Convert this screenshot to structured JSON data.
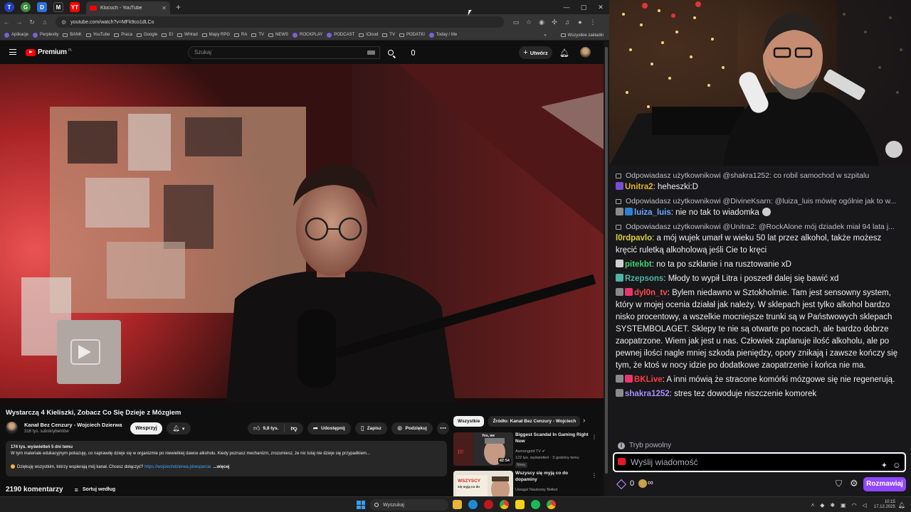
{
  "browser": {
    "tab_title": "Klocuch - YouTube",
    "pinned_tabs": [
      "T",
      "G",
      "D",
      "M",
      "YT"
    ],
    "url": "youtube.com/watch?v=MFk9co1dLCo",
    "bookmarks": [
      "Aplikacje",
      "Perplexity",
      "BANK",
      "YouTube",
      "Praca",
      "Google",
      "EI",
      "WHrad",
      "Mapy RPG",
      "RA",
      "TV",
      "NEWS",
      "ROCKPLAY",
      "PODCAST",
      "iCloud",
      "TV",
      "PODATKI",
      "Today / Me"
    ],
    "bookmarks_more": "»",
    "all_bookmarks": "Wszystkie zakładki"
  },
  "youtube": {
    "logo_text": "Premium",
    "logo_sup": "PL",
    "search_placeholder": "Szukaj",
    "create_label": "Utwórz",
    "video": {
      "title": "Wystarczą 4 Kieliszki, Zobacz Co Się Dzieje z Mózgiem",
      "channel": "Kanał Bez Cenzury - Wojciech Dzierwa",
      "subscribers": "316 tys. subskrybentów",
      "support_label": "Wesprzyj",
      "likes": "9,8 tys.",
      "share_label": "Udostępnij",
      "save_label": "Zapisz",
      "thanks_label": "Podziękuj",
      "views_meta": "174 tys. wyświetleń  5 dni temu",
      "description": "W tym materiale edukacyjnym pokazuję, co naprawdę dzieje się w organizmie po niewielkiej dawce alkoholu. Kiedy poznasz mechanizm, zrozumiesz, że nic tutaj nie dzieje się przypadkiem...",
      "description_line2": "Dziękuję wszystkim, którzy wspierają mój kanał. Chcesz dołączyć? ",
      "link": "https://wojciechdzierwa.pl/wsparcie",
      "more_label": "...więcej",
      "comments_count": "2190 komentarzy",
      "sort_label": "Sortuj według"
    },
    "chips": [
      "Wszystkie",
      "Źródło: Kanał Bez Cenzury - Wojciech"
    ],
    "recommendations": [
      {
        "title": "Biggest Scandal In Gaming Right Now",
        "channel": "Asmongold TV",
        "meta": "122 tys. wyświetleń · 3 godziny temu",
        "badge": "Nowy",
        "duration": "42:54",
        "thumb_text": "Yes, we"
      },
      {
        "title": "Wszyscy się myją co do dopaminy",
        "channel": "Uwaga! Naukowy Bełkot",
        "meta": "",
        "badge": "",
        "duration": "",
        "thumb_text": "WSZYSCY się myją co do"
      }
    ]
  },
  "chat": {
    "messages": [
      {
        "type": "reply",
        "text": "Odpowiadasz użytkownikowi @shakra1252: co robil samochod w szpitalu"
      },
      {
        "type": "msg",
        "user": "Unitra2",
        "color": "#e2b12c",
        "badges": [
          "#7b4dd6"
        ],
        "text": "heheszki:D"
      },
      {
        "type": "reply",
        "text": "Odpowiadasz użytkownikowi @DivineKsarn: @luiza_luis mówię ogólnie jak to w..."
      },
      {
        "type": "msg",
        "user": "luiza_luis",
        "color": "#6ba7ff",
        "badges": [
          "#8a8a8a",
          "#2e7fd6"
        ],
        "text": "nie no tak to wiadomka",
        "emote": true
      },
      {
        "type": "reply",
        "text": "Odpowiadasz użytkownikowi @Unitra2: @RockAlone mój dziadek miał 94 lata j..."
      },
      {
        "type": "msg",
        "user": "l0rdpavlo",
        "color": "#e0d23a",
        "badges": [],
        "text": "a mój wujek umarł w wieku 50 lat przez alkohol, także możesz kręcić ruletką alkoholową jeśli Cie to kręci"
      },
      {
        "type": "msg",
        "user": "pitekbt",
        "color": "#3fd16f",
        "badges": [
          "#cfcfcf"
        ],
        "text": "no ta po szklanie i na rusztowanie xD"
      },
      {
        "type": "msg",
        "user": "Rzepsons",
        "color": "#4fb3a6",
        "badges": [
          "#4fb3a6"
        ],
        "text": "Młody to wypił Litra i poszedł dalej się bawić xd"
      },
      {
        "type": "msg",
        "user": "dyl0n_tv",
        "color": "#ff4a4a",
        "badges": [
          "#8a8a8a",
          "#e9356e"
        ],
        "text": "Bylem niedawno w Sztokholmie. Tam jest sensowny system, który w mojej ocenia działał jak należy. W sklepach jest tylko alkohol bardzo nisko procentowy, a wszelkie mocniejsze trunki są w Państwowych sklepach SYSTEMBOLAGET. Sklepy te nie są otwarte po nocach, ale bardzo dobrze zaopatrzone. Wiem jak jest u nas. Człowiek zaplanuje ilość alkoholu, ale po pewnej ilości nagle mniej szkoda pieniędzy, opory znikają i zawsze kończy się tym, że ktoś w nocy idzie po dodatkowe zaopatrzenie i końca nie ma."
      },
      {
        "type": "msg",
        "user": "BKLive",
        "color": "#ff3b3b",
        "badges": [
          "#8a8a8a",
          "#e9356e"
        ],
        "text": "A inni mówią że stracone komórki mózgowe się nie regenerują."
      },
      {
        "type": "msg",
        "user": "shakra1252",
        "color": "#a98bff",
        "badges": [
          "#8a8a8a"
        ],
        "text": "stres tez dowoduje niszczenie komorek"
      }
    ],
    "slow_mode": "Tryb powolny",
    "input_placeholder": "Wyślij wiadomość",
    "points": "0",
    "infinity": "∞",
    "chat_button": "Rozmawiaj"
  },
  "taskbar": {
    "search": "Wyszukaj",
    "time": "10:15",
    "date": "17.12.2025"
  },
  "colors": {
    "yt_red": "#ff0000",
    "twitch_purple": "#9147ff",
    "link": "#3ea6ff"
  }
}
